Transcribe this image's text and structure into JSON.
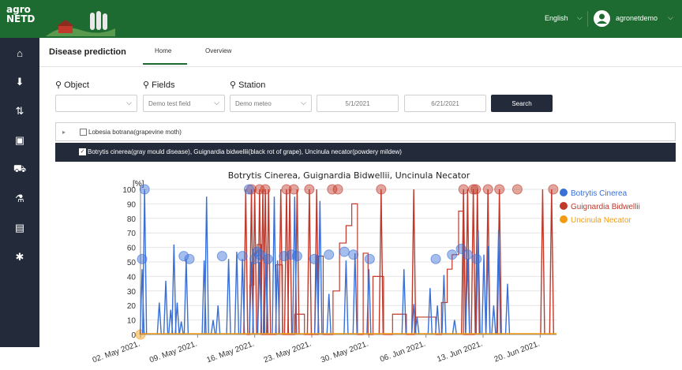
{
  "app": {
    "logo_top": "agro",
    "logo_bottom": "NETD"
  },
  "header": {
    "language": "English",
    "username": "agronetdemo"
  },
  "sidebar": {
    "items": [
      {
        "icon": "home-icon",
        "glyph": "⌂"
      },
      {
        "icon": "download-icon",
        "glyph": "⬇"
      },
      {
        "icon": "sort-icon",
        "glyph": "⇅"
      },
      {
        "icon": "building-icon",
        "glyph": "▣"
      },
      {
        "icon": "tractor-icon",
        "glyph": "⛟"
      },
      {
        "icon": "sprayer-icon",
        "glyph": "⚗"
      },
      {
        "icon": "report-icon",
        "glyph": "▤"
      },
      {
        "icon": "settings-icon",
        "glyph": "✱"
      }
    ]
  },
  "page": {
    "title": "Disease prediction",
    "tabs": [
      {
        "label": "Home"
      },
      {
        "label": "Overview"
      }
    ]
  },
  "filters": {
    "object_label": "Object",
    "fields_label": "Fields",
    "station_label": "Station",
    "object_value": "",
    "fields_value": "Demo test field",
    "station_value": "Demo meteo",
    "date_from": "5/1/2021",
    "date_to": "6/21/2021",
    "search_label": "Search"
  },
  "accordions": [
    {
      "label": "Lobesia botrana(grapevine moth)",
      "checked": false
    },
    {
      "label": "Botrytis cinerea(gray mould disease), Guignardia bidwellii(black rot of grape), Uncinula necator(powdery mildew)",
      "checked": true
    }
  ],
  "chart_data": {
    "type": "line",
    "title": "Botrytis Cinerea, Guignardia Bidwellii, Uncinula Necator",
    "ylabel": "[%]",
    "ylim": [
      0,
      100
    ],
    "yticks": [
      0,
      10,
      20,
      30,
      40,
      50,
      60,
      70,
      80,
      90,
      100
    ],
    "xlabels": [
      "02. May 2021.",
      "09. May 2021.",
      "16. May 2021.",
      "23. May 2021.",
      "30. May 2021.",
      "06. Jun 2021.",
      "13. Jun 2021.",
      "20. Jun 2021."
    ],
    "xrange_days": [
      0,
      51
    ],
    "legend_position": "right",
    "series": [
      {
        "name": "Botrytis Cinerea",
        "color": "#3a6fd6",
        "spikes": [
          [
            0.2,
            45
          ],
          [
            0.5,
            100
          ],
          [
            2.3,
            22
          ],
          [
            3.1,
            37
          ],
          [
            3.7,
            17
          ],
          [
            4.1,
            62
          ],
          [
            4.5,
            22
          ],
          [
            5.0,
            9
          ],
          [
            5.6,
            52
          ],
          [
            7.8,
            51
          ],
          [
            8.1,
            95
          ],
          [
            8.9,
            10
          ],
          [
            9.5,
            20
          ],
          [
            10.8,
            52
          ],
          [
            11.8,
            57
          ],
          [
            12.5,
            52
          ],
          [
            13.6,
            50
          ],
          [
            14.6,
            50
          ],
          [
            15.4,
            57
          ],
          [
            16.4,
            95
          ],
          [
            16.8,
            51
          ],
          [
            18.9,
            95
          ],
          [
            21.6,
            55
          ],
          [
            22.0,
            92
          ],
          [
            23.1,
            28
          ],
          [
            25.2,
            51
          ],
          [
            26.3,
            56
          ],
          [
            28.0,
            45
          ],
          [
            32.3,
            45
          ],
          [
            33.5,
            21
          ],
          [
            33.9,
            12
          ],
          [
            35.5,
            32
          ],
          [
            36.4,
            20
          ],
          [
            37.2,
            41
          ],
          [
            38.5,
            10
          ],
          [
            40.1,
            52
          ],
          [
            41.4,
            72
          ],
          [
            42.1,
            55
          ],
          [
            42.6,
            61
          ],
          [
            43.3,
            20
          ],
          [
            43.9,
            72
          ],
          [
            45.0,
            35
          ]
        ],
        "markers": [
          [
            0.2,
            52
          ],
          [
            0.5,
            100
          ],
          [
            5.3,
            54
          ],
          [
            6.0,
            52
          ],
          [
            10.0,
            54
          ],
          [
            12.5,
            54
          ],
          [
            13.3,
            100
          ],
          [
            14.0,
            52
          ],
          [
            14.3,
            57
          ],
          [
            14.6,
            55
          ],
          [
            15.6,
            52
          ],
          [
            17.6,
            54
          ],
          [
            18.5,
            55
          ],
          [
            19.2,
            54
          ],
          [
            21.3,
            52
          ],
          [
            23.1,
            55
          ],
          [
            25.0,
            57
          ],
          [
            26.1,
            55
          ],
          [
            28.1,
            52
          ],
          [
            36.2,
            52
          ],
          [
            38.2,
            55
          ],
          [
            39.3,
            59
          ],
          [
            40.1,
            55
          ],
          [
            41.2,
            52
          ]
        ]
      },
      {
        "name": "Guignardia Bidwellii",
        "color": "#c0392b",
        "spikes": [
          [
            12.9,
            100
          ],
          [
            13.6,
            100
          ],
          [
            14.0,
            100
          ],
          [
            14.6,
            100
          ],
          [
            15.0,
            100
          ],
          [
            15.3,
            100
          ],
          [
            15.7,
            100
          ],
          [
            17.2,
            100
          ],
          [
            17.9,
            100
          ],
          [
            18.3,
            100
          ],
          [
            19.2,
            100
          ],
          [
            20.7,
            100
          ],
          [
            21.6,
            100
          ],
          [
            29.5,
            100
          ],
          [
            33.5,
            100
          ],
          [
            39.6,
            100
          ],
          [
            40.1,
            100
          ],
          [
            40.8,
            100
          ],
          [
            41.3,
            100
          ],
          [
            42.6,
            100
          ],
          [
            44.0,
            100
          ],
          [
            49.3,
            100
          ],
          [
            50.4,
            100
          ]
        ],
        "markers": [
          [
            13.6,
            100
          ],
          [
            14.6,
            100
          ],
          [
            15.3,
            100
          ],
          [
            17.9,
            100
          ],
          [
            18.8,
            100
          ],
          [
            20.7,
            100
          ],
          [
            23.5,
            100
          ],
          [
            24.2,
            100
          ],
          [
            29.5,
            100
          ],
          [
            39.6,
            100
          ],
          [
            40.8,
            100
          ],
          [
            41.1,
            100
          ],
          [
            42.6,
            100
          ],
          [
            44.0,
            100
          ],
          [
            46.2,
            100
          ],
          [
            50.6,
            100
          ]
        ],
        "steps": [
          [
            13.0,
            0
          ],
          [
            13.4,
            34
          ],
          [
            13.9,
            56
          ],
          [
            14.3,
            62
          ],
          [
            14.8,
            0
          ],
          [
            16.6,
            48
          ],
          [
            17.4,
            0
          ],
          [
            18.9,
            14
          ],
          [
            19.5,
            14
          ],
          [
            20.1,
            0
          ],
          [
            21.8,
            54
          ],
          [
            22.4,
            0
          ],
          [
            23.6,
            30
          ],
          [
            24.4,
            63
          ],
          [
            25.2,
            75
          ],
          [
            25.9,
            90
          ],
          [
            26.6,
            0
          ],
          [
            27.3,
            56
          ],
          [
            27.9,
            0
          ],
          [
            28.5,
            40
          ],
          [
            29.8,
            0
          ],
          [
            30.9,
            14
          ],
          [
            32.0,
            14
          ],
          [
            32.6,
            0
          ],
          [
            33.6,
            12
          ],
          [
            34.3,
            12
          ],
          [
            35.2,
            12
          ],
          [
            36.2,
            0
          ],
          [
            36.9,
            22
          ],
          [
            37.6,
            45
          ],
          [
            38.2,
            55
          ],
          [
            39.0,
            85
          ],
          [
            39.6,
            0
          ],
          [
            40.5,
            0
          ],
          [
            41.0,
            0
          ]
        ]
      },
      {
        "name": "Uncinula Necator",
        "color": "#f39c12",
        "spikes": [],
        "markers": [
          [
            0.0,
            0
          ]
        ]
      }
    ]
  }
}
